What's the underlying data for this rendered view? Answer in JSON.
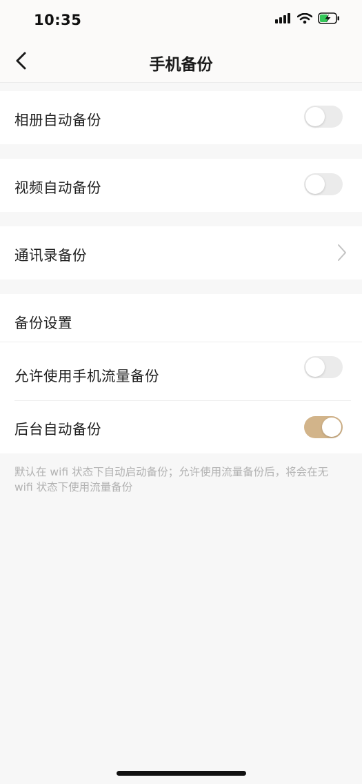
{
  "status_bar": {
    "time": "10:35",
    "icons": [
      "signal-icon",
      "wifi-icon",
      "battery-charging-icon"
    ]
  },
  "header": {
    "title": "手机备份",
    "back_icon": "chevron-left-icon"
  },
  "settings": {
    "album_backup": {
      "label": "相册自动备份",
      "enabled": false
    },
    "video_backup": {
      "label": "视频自动备份",
      "enabled": false
    },
    "contacts_backup": {
      "label": "通讯录备份",
      "icon": "chevron-right-icon"
    },
    "section_title": "备份设置",
    "cellular_backup": {
      "label": "允许使用手机流量备份",
      "enabled": false
    },
    "background_backup": {
      "label": "后台自动备份",
      "enabled": true
    }
  },
  "footnote": "默认在 wifi 状态下自动启动备份；允许使用流量备份后，将会在无 wifi 状态下使用流量备份",
  "colors": {
    "accent": "#d2b48a",
    "toggle_off": "#ebebeb",
    "page_bg": "#f7f7f7",
    "footnote_text": "#b2b2b2"
  }
}
